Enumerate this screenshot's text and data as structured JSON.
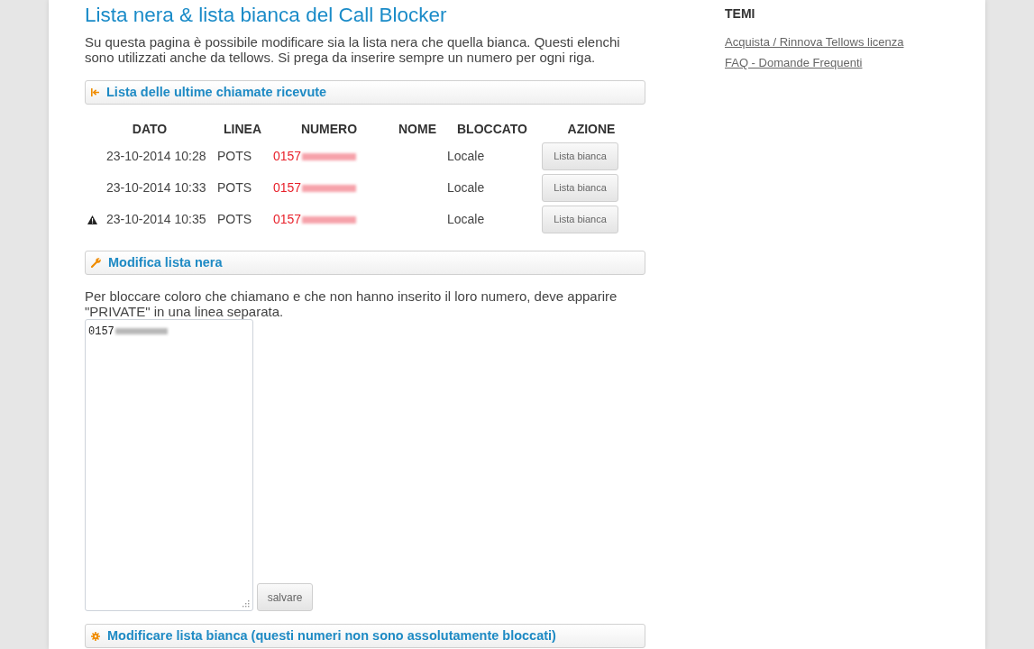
{
  "page": {
    "title": "Lista nera & lista bianca del Call Blocker",
    "intro": "Su questa pagina è possibile modificare sia la lista nera che quella bianca. Questi elenchi sono utilizzati anche da tellows. Si prega da inserire sempre un numero per ogni riga."
  },
  "sections": [
    {
      "kind": "calls",
      "title": "Lista delle ultime chiamate ricevute",
      "columns": [
        "DATO",
        "LINEA",
        "NUMERO",
        "NOME",
        "BLOCCATO",
        "AZIONE"
      ],
      "rows": [
        {
          "warning": false,
          "date": "23-10-2014 10:28",
          "line": "POTS",
          "number": "0157",
          "blocked": "Locale",
          "action": "Lista bianca"
        },
        {
          "warning": false,
          "date": "23-10-2014 10:33",
          "line": "POTS",
          "number": "0157",
          "blocked": "Locale",
          "action": "Lista bianca"
        },
        {
          "warning": true,
          "date": "23-10-2014 10:35",
          "line": "POTS",
          "number": "0157",
          "blocked": "Locale",
          "action": "Lista bianca"
        }
      ]
    },
    {
      "kind": "blacklist",
      "title": "Modifica lista nera",
      "note": "Per bloccare coloro che chiamano e che non hanno inserito il loro numero, deve apparire \"PRIVATE\" in una linea separata.",
      "value": "0157",
      "button": "salvare"
    },
    {
      "kind": "whitelist",
      "title": "Modificare lista bianca (questi numeri non sono assolutamente bloccati)"
    }
  ],
  "sidebar": {
    "heading": "TEMI",
    "links": [
      "Acquista / Rinnova Tellows licenza",
      "FAQ - Domande Frequenti"
    ]
  }
}
